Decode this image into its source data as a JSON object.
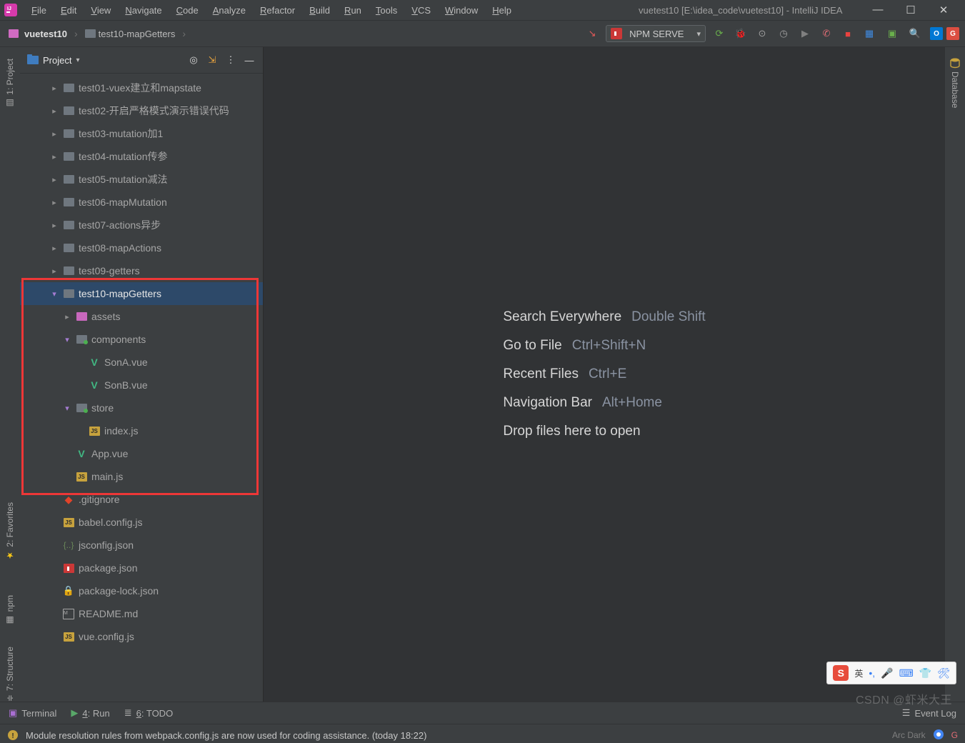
{
  "window": {
    "title": "vuetest10 [E:\\idea_code\\vuetest10] - IntelliJ IDEA"
  },
  "menu": [
    "File",
    "Edit",
    "View",
    "Navigate",
    "Code",
    "Analyze",
    "Refactor",
    "Build",
    "Run",
    "Tools",
    "VCS",
    "Window",
    "Help"
  ],
  "breadcrumb": {
    "root": "vuetest10",
    "path": "test10-mapGetters"
  },
  "run": {
    "config": "NPM SERVE"
  },
  "project_panel": {
    "title": "Project"
  },
  "tree": {
    "items": [
      {
        "depth": 1,
        "arrow": "▸",
        "icon": "folder",
        "label": "test01-vuex建立和mapstate"
      },
      {
        "depth": 1,
        "arrow": "▸",
        "icon": "folder",
        "label": "test02-开启严格模式演示错误代码"
      },
      {
        "depth": 1,
        "arrow": "▸",
        "icon": "folder",
        "label": "test03-mutation加1"
      },
      {
        "depth": 1,
        "arrow": "▸",
        "icon": "folder",
        "label": "test04-mutation传参"
      },
      {
        "depth": 1,
        "arrow": "▸",
        "icon": "folder",
        "label": "test05-mutation减法"
      },
      {
        "depth": 1,
        "arrow": "▸",
        "icon": "folder",
        "label": "test06-mapMutation"
      },
      {
        "depth": 1,
        "arrow": "▸",
        "icon": "folder",
        "label": "test07-actions异步"
      },
      {
        "depth": 1,
        "arrow": "▸",
        "icon": "folder",
        "label": "test08-mapActions"
      },
      {
        "depth": 1,
        "arrow": "▸",
        "icon": "folder",
        "label": "test09-getters"
      },
      {
        "depth": 1,
        "arrow": "▾",
        "icon": "folder",
        "label": "test10-mapGetters",
        "selected": true,
        "open": true
      },
      {
        "depth": 2,
        "arrow": "▸",
        "icon": "folder-pink",
        "label": "assets"
      },
      {
        "depth": 2,
        "arrow": "▾",
        "icon": "folder-dot",
        "label": "components",
        "open": true
      },
      {
        "depth": 3,
        "arrow": "",
        "icon": "vue",
        "label": "SonA.vue"
      },
      {
        "depth": 3,
        "arrow": "",
        "icon": "vue",
        "label": "SonB.vue"
      },
      {
        "depth": 2,
        "arrow": "▾",
        "icon": "folder-dot",
        "label": "store",
        "open": true
      },
      {
        "depth": 3,
        "arrow": "",
        "icon": "js",
        "label": "index.js"
      },
      {
        "depth": 2,
        "arrow": "",
        "icon": "vue",
        "label": "App.vue"
      },
      {
        "depth": 2,
        "arrow": "",
        "icon": "js",
        "label": "main.js"
      },
      {
        "depth": 1,
        "arrow": "",
        "icon": "git",
        "label": ".gitignore"
      },
      {
        "depth": 1,
        "arrow": "",
        "icon": "js",
        "label": "babel.config.js"
      },
      {
        "depth": 1,
        "arrow": "",
        "icon": "json",
        "label": "jsconfig.json"
      },
      {
        "depth": 1,
        "arrow": "",
        "icon": "npm",
        "label": "package.json"
      },
      {
        "depth": 1,
        "arrow": "",
        "icon": "lock",
        "label": "package-lock.json"
      },
      {
        "depth": 1,
        "arrow": "",
        "icon": "md",
        "label": "README.md"
      },
      {
        "depth": 1,
        "arrow": "",
        "icon": "js",
        "label": "vue.config.js"
      }
    ],
    "highlight_start": 9,
    "highlight_end": 17
  },
  "hints": [
    {
      "label": "Search Everywhere",
      "key": "Double Shift"
    },
    {
      "label": "Go to File",
      "key": "Ctrl+Shift+N"
    },
    {
      "label": "Recent Files",
      "key": "Ctrl+E"
    },
    {
      "label": "Navigation Bar",
      "key": "Alt+Home"
    },
    {
      "label": "Drop files here to open",
      "key": ""
    }
  ],
  "left_tabs": {
    "project": "1: Project",
    "favorites": "2: Favorites",
    "npm": "npm",
    "structure": "7: Structure"
  },
  "right_tabs": {
    "database": "Database"
  },
  "bottom_tabs": {
    "terminal": "Terminal",
    "run": "4: Run",
    "todo": "6: TODO",
    "eventlog": "Event Log"
  },
  "status": {
    "message": "Module resolution rules from webpack.config.js are now used for coding assistance. (today 18:22)",
    "theme": "Arc Dark"
  },
  "watermark": "CSDN @虾米大王",
  "ime": {
    "lang": "英"
  }
}
